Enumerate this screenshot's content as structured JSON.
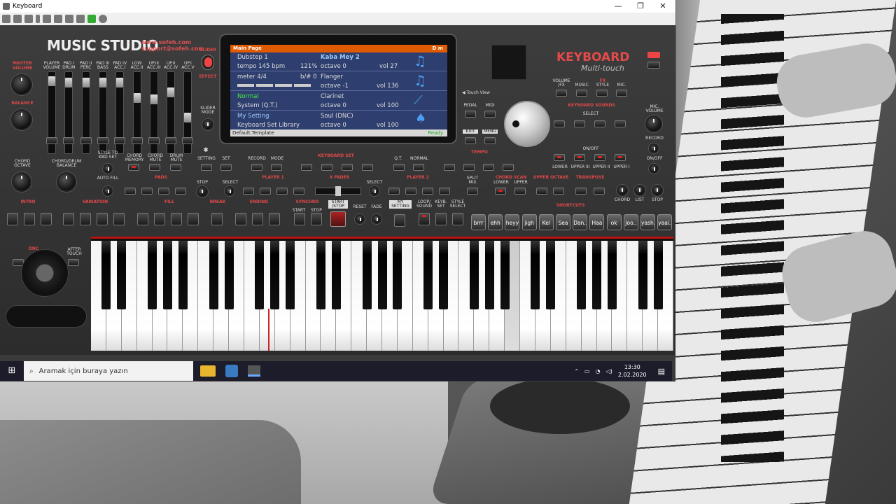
{
  "window": {
    "title": "Keyboard",
    "controls": [
      "—",
      "❐",
      "✕"
    ]
  },
  "app": {
    "logo": "MUSIC STUDIO",
    "site1": "www.sofeh.com",
    "site2": "support@sofeh.com",
    "keyboard_title": "KEYBOARD",
    "keyboard_sub": "Multi-touch",
    "touch_view": "◀ Touch View"
  },
  "left_labels": {
    "master_volume": "MASTER VOLUME",
    "balance": "BALANCE",
    "chord_octave": "CHORD OCTAVE",
    "chord_drum_balance": "CHORD/DRUM BALANCE",
    "slider": "SLIDER",
    "effect": "EFFECT",
    "slider_mode": "SLIDER MODE",
    "sliders": [
      "PLAYER VOLUME",
      "PAD I DRUM",
      "PAD II PERC",
      "PAD III BASS",
      "PAD IV ACC.I",
      "LOW ACC.II",
      "UP.III ACC.III",
      "UP.II ACC.IV",
      "UP.I ACC.V"
    ]
  },
  "lcd": {
    "header": "Main Page",
    "header_right": "D m",
    "rows": [
      {
        "l1": "Dubstep 1",
        "l2": "tempo 145 bpm",
        "l2r": "121%",
        "r1": "Kaba Mey 2",
        "r2": "octave 0",
        "r2r": "vol 27"
      },
      {
        "l1": "meter 4/4",
        "l1r": "b/# 0",
        "r1": "Flanger",
        "r2": "octave -1",
        "r2r": "vol 136"
      },
      {
        "l1": "Normal",
        "l2": "System (Q.T.)",
        "r1": "Clarinet",
        "r2": "octave 0",
        "r2r": "vol 100"
      },
      {
        "l1": "My Setting",
        "l2": "Keyboard Set Library",
        "r1": "Soul (DNC)",
        "r2": "octave 0",
        "r2r": "vol 100"
      }
    ],
    "footer": "Default.Template",
    "footer_right": "Ready"
  },
  "right_panel": {
    "volume_fx": "VOLUME /FX",
    "music": "MUSIC",
    "style": "STYLE",
    "mic": "MIC.",
    "fx": "FX",
    "pedal": "PEDAL",
    "midi": "MIDI",
    "exit": "EXIT",
    "menu": "MENU",
    "keyboard_sounds": "KEYBOARD SOUNDS",
    "select": "SELECT",
    "on_off": "ON/OFF",
    "mic_volume": "MIC. VOLUME",
    "record": "RECORD",
    "on_off2": "ON/OFF",
    "lower": "LOWER",
    "upper_iii": "UPPER III",
    "upper_ii": "UPPER II",
    "upper_i": "UPPER I"
  },
  "mid_row": {
    "style_to_kbd_set": "STYLE TO KBD SET",
    "chord_memory": "CHORD MEMORY",
    "chord_mute": "CHORD MUTE",
    "drum_mute": "DRUM MUTE",
    "setting": "SETTING",
    "set": "SET",
    "record": "RECORD",
    "mode": "MODE",
    "keyboard_set": "KEYBOARD SET",
    "qt": "Q.T.",
    "normal": "NORMAL",
    "tempo": "TEMPO",
    "auto_fill": "AUTO FILL",
    "pads": "PADS",
    "stop": "STOP",
    "select": "SELECT",
    "player1": "PLAYER 1",
    "x_fader": "X FADER",
    "player2": "PLAYER 2",
    "split_mix": "SPLIT MIX",
    "chord_scan": "CHORD SCAN",
    "lower": "LOWER",
    "upper": "UPPER",
    "upper_octave": "UPPER OCTAVE",
    "transpose": "TRANSPOSE",
    "chord": "CHORD",
    "list": "LIST",
    "stop2": "STOP"
  },
  "bottom_row": {
    "intro": "INTRO",
    "variation": "VARIATION",
    "fill": "FILL",
    "break": "BREAK",
    "ending": "ENDING",
    "synchro": "SYNCHRO",
    "start": "START",
    "stop": "STOP",
    "start_stop": "START /STOP",
    "reset": "RESET",
    "fade": "FADE",
    "my_setting": "MY SETTING",
    "loop_sound": "LOOP/ SOUND",
    "keyb_set": "KEYB. SET",
    "style_select": "STYLE SELECT",
    "shortcuts": "SHORTCUTS",
    "dnc": "DNC",
    "after_touch": "AFTER TOUCH"
  },
  "shortcuts": [
    "brrr",
    "ehh",
    "heyy",
    "jigh",
    "Kel",
    "Sea",
    "Dan..",
    "Haa",
    "ok",
    "Joo..",
    "yash..",
    "yaai.."
  ],
  "taskbar": {
    "search": "Aramak için buraya yazın",
    "time": "13:30",
    "date": "2.02.2020"
  }
}
